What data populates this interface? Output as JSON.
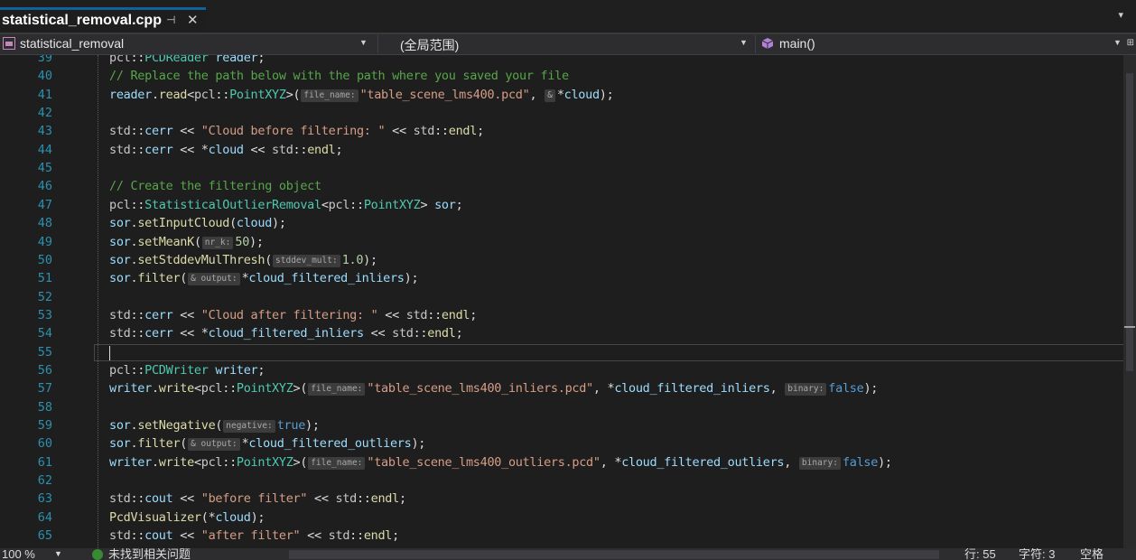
{
  "tab": {
    "title": "statistical_removal.cpp",
    "pin_glyph": "⊣",
    "close_glyph": "✕",
    "overflow_glyph": "▾"
  },
  "nav": {
    "project": "statistical_removal",
    "scope": "(全局范围)",
    "member": "main()"
  },
  "editor": {
    "current_line": 55,
    "lines": [
      {
        "n": "39",
        "html": "<span class='tk-ns'>pcl</span>::<span class='tk-ty'>PCDReader</span> <span class='tk-var'>reader</span>;"
      },
      {
        "n": "40",
        "html": "<span class='tk-com'>// Replace the path below with the path where you saved your file</span>"
      },
      {
        "n": "41",
        "html": "<span class='tk-var'>reader</span>.<span class='tk-fn'>read</span>&lt;<span class='tk-ns'>pcl</span>::<span class='tk-ty'>PointXYZ</span>&gt;(<span class='hint'>file_name:</span><span class='tk-str'>\"table_scene_lms400.pcd\"</span>, <span class='hint'>&amp;</span>*<span class='tk-var'>cloud</span>);"
      },
      {
        "n": "42",
        "html": ""
      },
      {
        "n": "43",
        "html": "<span class='tk-ns'>std</span>::<span class='tk-var'>cerr</span> &lt;&lt; <span class='tk-str'>\"Cloud before filtering: \"</span> &lt;&lt; <span class='tk-ns'>std</span>::<span class='tk-fn'>endl</span>;"
      },
      {
        "n": "44",
        "html": "<span class='tk-ns'>std</span>::<span class='tk-var'>cerr</span> &lt;&lt; *<span class='tk-var'>cloud</span> &lt;&lt; <span class='tk-ns'>std</span>::<span class='tk-fn'>endl</span>;"
      },
      {
        "n": "45",
        "html": ""
      },
      {
        "n": "46",
        "html": "<span class='tk-com'>// Create the filtering object</span>"
      },
      {
        "n": "47",
        "html": "<span class='tk-ns'>pcl</span>::<span class='tk-ty'>StatisticalOutlierRemoval</span>&lt;<span class='tk-ns'>pcl</span>::<span class='tk-ty'>PointXYZ</span>&gt; <span class='tk-var'>sor</span>;"
      },
      {
        "n": "48",
        "html": "<span class='tk-var'>sor</span>.<span class='tk-fn'>setInputCloud</span>(<span class='tk-var'>cloud</span>);"
      },
      {
        "n": "49",
        "html": "<span class='tk-var'>sor</span>.<span class='tk-fn'>setMeanK</span>(<span class='hint'>nr_k:</span><span class='tk-num'>50</span>);"
      },
      {
        "n": "50",
        "html": "<span class='tk-var'>sor</span>.<span class='tk-fn'>setStddevMulThresh</span>(<span class='hint'>stddev_mult:</span><span class='tk-num'>1.0</span>);"
      },
      {
        "n": "51",
        "html": "<span class='tk-var'>sor</span>.<span class='tk-fn'>filter</span>(<span class='hint'>&amp; output:</span>*<span class='tk-var'>cloud_filtered_inliers</span>);"
      },
      {
        "n": "52",
        "html": ""
      },
      {
        "n": "53",
        "html": "<span class='tk-ns'>std</span>::<span class='tk-var'>cerr</span> &lt;&lt; <span class='tk-str'>\"Cloud after filtering: \"</span> &lt;&lt; <span class='tk-ns'>std</span>::<span class='tk-fn'>endl</span>;"
      },
      {
        "n": "54",
        "html": "<span class='tk-ns'>std</span>::<span class='tk-var'>cerr</span> &lt;&lt; *<span class='tk-var'>cloud_filtered_inliers</span> &lt;&lt; <span class='tk-ns'>std</span>::<span class='tk-fn'>endl</span>;"
      },
      {
        "n": "55",
        "html": ""
      },
      {
        "n": "56",
        "html": "<span class='tk-ns'>pcl</span>::<span class='tk-ty'>PCDWriter</span> <span class='tk-var'>writer</span>;"
      },
      {
        "n": "57",
        "html": "<span class='tk-var'>writer</span>.<span class='tk-fn'>write</span>&lt;<span class='tk-ns'>pcl</span>::<span class='tk-ty'>PointXYZ</span>&gt;(<span class='hint'>file_name:</span><span class='tk-str'>\"table_scene_lms400_inliers.pcd\"</span>, *<span class='tk-var'>cloud_filtered_inliers</span>, <span class='hint'>binary:</span><span class='tk-kw'>false</span>);"
      },
      {
        "n": "58",
        "html": ""
      },
      {
        "n": "59",
        "html": "<span class='tk-var'>sor</span>.<span class='tk-fn'>setNegative</span>(<span class='hint'>negative:</span><span class='tk-kw'>true</span>);"
      },
      {
        "n": "60",
        "html": "<span class='tk-var'>sor</span>.<span class='tk-fn'>filter</span>(<span class='hint'>&amp; output:</span>*<span class='tk-var'>cloud_filtered_outliers</span>);"
      },
      {
        "n": "61",
        "html": "<span class='tk-var'>writer</span>.<span class='tk-fn'>write</span>&lt;<span class='tk-ns'>pcl</span>::<span class='tk-ty'>PointXYZ</span>&gt;(<span class='hint'>file_name:</span><span class='tk-str'>\"table_scene_lms400_outliers.pcd\"</span>, *<span class='tk-var'>cloud_filtered_outliers</span>, <span class='hint'>binary:</span><span class='tk-kw'>false</span>);"
      },
      {
        "n": "62",
        "html": ""
      },
      {
        "n": "63",
        "html": "<span class='tk-ns'>std</span>::<span class='tk-var'>cout</span> &lt;&lt; <span class='tk-str'>\"before filter\"</span> &lt;&lt; <span class='tk-ns'>std</span>::<span class='tk-fn'>endl</span>;"
      },
      {
        "n": "64",
        "html": "<span class='tk-fn'>PcdVisualizer</span>(*<span class='tk-var'>cloud</span>);"
      },
      {
        "n": "65",
        "html": "<span class='tk-ns'>std</span>::<span class='tk-var'>cout</span> &lt;&lt; <span class='tk-str'>\"after filter\"</span> &lt;&lt; <span class='tk-ns'>std</span>::<span class='tk-fn'>endl</span>;"
      }
    ]
  },
  "status": {
    "zoom": "100 %",
    "issues": "未找到相关问题",
    "line": "行: 55",
    "char": "字符: 3",
    "indent": "空格"
  },
  "colors": {
    "accent": "#0e639c",
    "background": "#1e1e1e",
    "line_number": "#2b91af"
  }
}
